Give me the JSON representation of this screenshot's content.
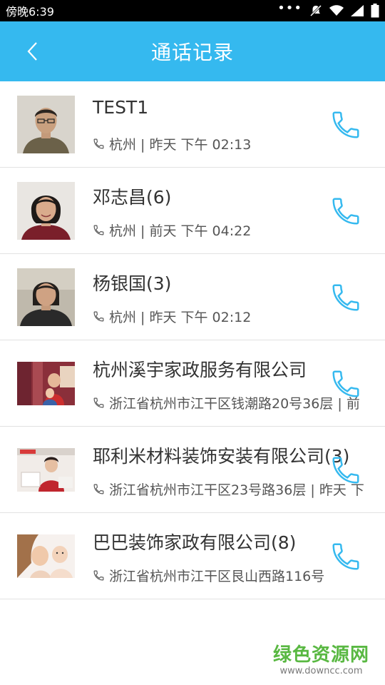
{
  "status_bar": {
    "time": "傍晚6:39",
    "icons": [
      "more-dots-icon",
      "notifications-off-icon",
      "wifi-icon",
      "signal-icon",
      "battery-icon"
    ]
  },
  "header": {
    "title": "通话记录",
    "back_icon": "chevron-left-icon",
    "background_color": "#35b9ef"
  },
  "records": [
    {
      "name": "TEST1",
      "detail": "杭州 | 昨天 下午  02:13"
    },
    {
      "name": "邓志昌(6)",
      "detail": "杭州 | 前天 下午  04:22"
    },
    {
      "name": "杨银国(3)",
      "detail": "杭州 | 昨天 下午  02:12"
    },
    {
      "name": "杭州溪宇家政服务有限公司",
      "detail": "浙江省杭州市江干区钱潮路20号36层 | 前"
    },
    {
      "name": "耶利米材料装饰安装有限公司(3)",
      "detail": "浙江省杭州市江干区23号路36层 | 昨天 下"
    },
    {
      "name": "巴巴装饰家政有限公司(8)",
      "detail": "浙江省杭州市江干区艮山西路116号"
    }
  ],
  "call_icon": "phone-icon",
  "call_icon_color": "#35b9ef",
  "watermark": {
    "name": "绿色资源网",
    "url": "www.downcc.com"
  }
}
